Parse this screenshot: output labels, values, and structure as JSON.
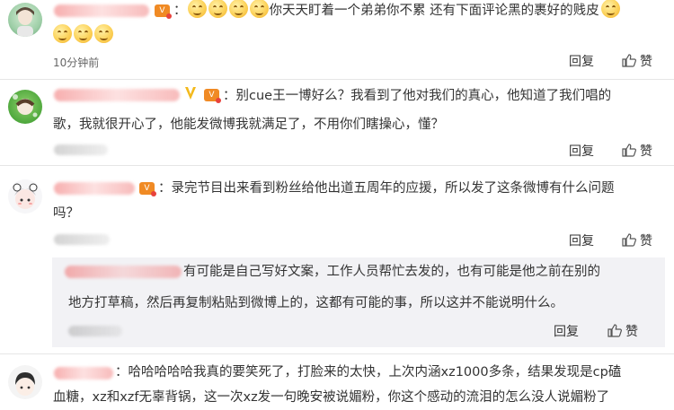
{
  "comments": [
    {
      "text_line1": "你天天盯着一个弟弟你不累 还有下面评论黑的裹好的贱皮",
      "time": "10分钟前",
      "reply_label": "回复",
      "like_label": "赞"
    },
    {
      "text_line1": "别cue王一博好么？我看到了他对我们的真心，他知道了我们唱的",
      "text_line2": "歌，我就很开心了，他能发微博我就满足了，不用你们瞎操心，懂？",
      "reply_label": "回复",
      "like_label": "赞"
    },
    {
      "text_line1": "录完节目出来看到粉丝给他出道五周年的应援，所以发了这条微博有什么问题",
      "text_line2": "吗？",
      "reply_label": "回复",
      "like_label": "赞"
    },
    {
      "text_line1": "哈哈哈哈哈我真的要笑死了，打脸来的太快，上次内涵xz1000多条，结果发现是cp磕",
      "text_line2": "血糖，xz和xzf无辜背锅，这一次xz发一句晚安被说媚粉，你这个感动的流泪的怎么没人说媚粉了"
    }
  ],
  "sub_reply": {
    "text_line1": "有可能是自己写好文案，工作人员帮忙去发的，也有可能是他之前在别的",
    "text_line2": "地方打草稿，然后再复制粘贴到微博上的，这都有可能的事，所以这并不能说明什么。",
    "reply_label": "回复",
    "like_label": "赞"
  },
  "colon": "：",
  "vip_glyph": "V"
}
